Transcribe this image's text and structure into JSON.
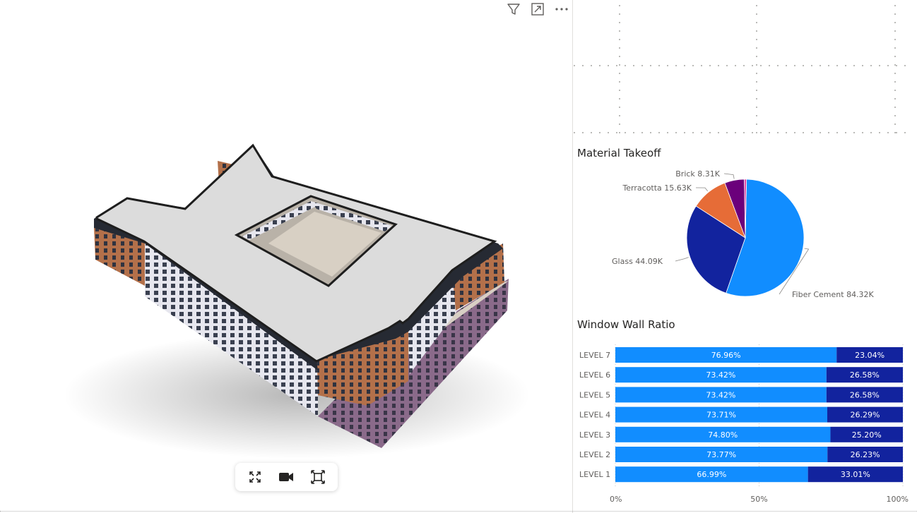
{
  "header_icons": [
    "filter-icon",
    "focus-mode-icon",
    "more-options-icon"
  ],
  "viewer": {
    "toolbar_icons": [
      "fullscreen-icon",
      "camera-icon",
      "reset-view-icon"
    ]
  },
  "material_takeoff": {
    "title": "Material Takeoff"
  },
  "window_wall_ratio": {
    "title": "Window Wall Ratio"
  },
  "colors": {
    "accent_light_blue": "#118DFF",
    "accent_dark_blue": "#12239E",
    "accent_orange": "#E66C37",
    "accent_purple": "#6B007B",
    "accent_pink": "#E044A7"
  },
  "chart_data": [
    {
      "type": "pie",
      "title": "Material Takeoff",
      "legend": "none",
      "slices": [
        {
          "label": "Fiber Cement",
          "value_label": "84.32K",
          "value": 84320,
          "color": "#118DFF"
        },
        {
          "label": "Glass",
          "value_label": "44.09K",
          "value": 44090,
          "color": "#12239E"
        },
        {
          "label": "Terracotta",
          "value_label": "15.63K",
          "value": 15630,
          "color": "#E66C37"
        },
        {
          "label": "Brick",
          "value_label": "8.31K",
          "value": 8310,
          "color": "#6B007B"
        },
        {
          "label": "",
          "value_label": "",
          "value": 900,
          "color": "#E044A7"
        }
      ]
    },
    {
      "type": "bar",
      "orientation": "horizontal-stacked-100",
      "title": "Window Wall Ratio",
      "categories": [
        "LEVEL 7",
        "LEVEL 6",
        "LEVEL 5",
        "LEVEL 4",
        "LEVEL 3",
        "LEVEL 2",
        "LEVEL 1"
      ],
      "series": [
        {
          "values": [
            76.96,
            73.42,
            73.42,
            73.71,
            74.8,
            73.77,
            66.99
          ],
          "labels": [
            "76.96%",
            "73.42%",
            "73.42%",
            "73.71%",
            "74.80%",
            "73.77%",
            "66.99%"
          ],
          "color": "#118DFF"
        },
        {
          "values": [
            23.04,
            26.58,
            26.58,
            26.29,
            25.2,
            26.23,
            33.01
          ],
          "labels": [
            "23.04%",
            "26.58%",
            "26.58%",
            "26.29%",
            "25.20%",
            "26.23%",
            "33.01%"
          ],
          "color": "#12239E"
        }
      ],
      "x_ticks": [
        "0%",
        "50%",
        "100%"
      ],
      "xlim": [
        0,
        100
      ],
      "grid": true
    }
  ]
}
